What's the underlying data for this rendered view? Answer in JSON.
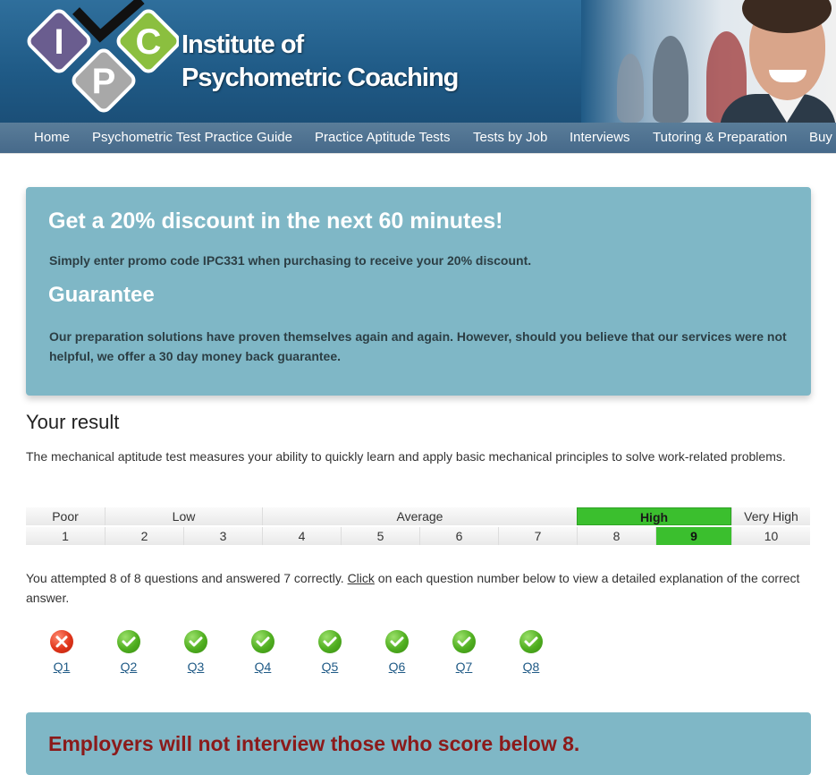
{
  "brand": {
    "line1": "Institute of",
    "line2": "Psychometric Coaching",
    "logo_letters": [
      "I",
      "C",
      "P"
    ]
  },
  "nav": [
    "Home",
    "Psychometric Test Practice Guide",
    "Practice Aptitude Tests",
    "Tests by Job",
    "Interviews",
    "Tutoring & Preparation",
    "Buy"
  ],
  "promo": {
    "title": "Get a 20% discount in the next 60 minutes!",
    "line": "Simply enter promo code IPC331 when purchasing to receive your 20% discount.",
    "guarantee_title": "Guarantee",
    "guarantee_text": "Our preparation solutions have proven themselves again and again. However, should you believe that our services were not helpful, we offer a 30 day money back guarantee."
  },
  "result": {
    "title": "Your result",
    "intro": "The mechanical aptitude test measures your ability to quickly learn and apply basic mechanical principles to solve work-related problems.",
    "bands": [
      "Poor",
      "Low",
      "Average",
      "High",
      "Very High"
    ],
    "scores": [
      "1",
      "2",
      "3",
      "4",
      "5",
      "6",
      "7",
      "8",
      "9",
      "10"
    ],
    "highlight_band": "High",
    "highlight_score": "9",
    "highlight_color": "#3bbf2e",
    "attempt_before": "You attempted 8 of 8 questions and answered 7 correctly.",
    "attempt_link": "Click",
    "attempt_after": "on each question number below to view a detailed explanation of the correct answer."
  },
  "questions": [
    {
      "label": "Q1",
      "status": "incorrect",
      "icon": "cross-icon"
    },
    {
      "label": "Q2",
      "status": "correct",
      "icon": "check-icon"
    },
    {
      "label": "Q3",
      "status": "correct",
      "icon": "check-icon"
    },
    {
      "label": "Q4",
      "status": "correct",
      "icon": "check-icon"
    },
    {
      "label": "Q5",
      "status": "correct",
      "icon": "check-icon"
    },
    {
      "label": "Q6",
      "status": "correct",
      "icon": "check-icon"
    },
    {
      "label": "Q7",
      "status": "correct",
      "icon": "check-icon"
    },
    {
      "label": "Q8",
      "status": "correct",
      "icon": "check-icon"
    }
  ],
  "employer_note": "Employers will not interview those who score below 8."
}
